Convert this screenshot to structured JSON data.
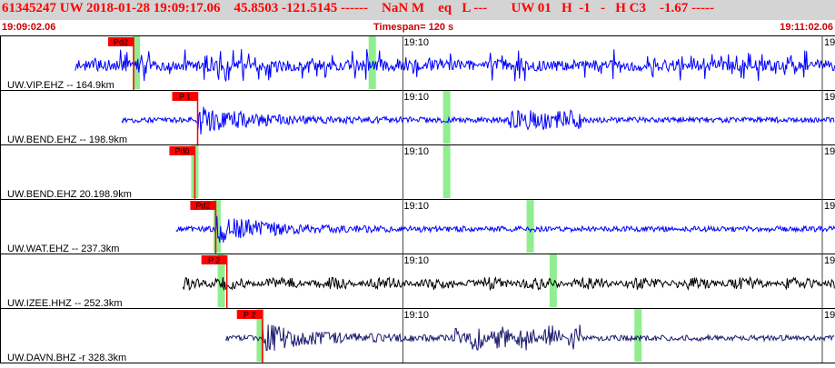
{
  "header": {
    "event_line": "61345247 UW 2018-01-28 19:09:17.06    45.8503 -121.5145 ------    NaN M    eq   L ---       UW 01   H  -1   -   H C3    -1.67 -----"
  },
  "timebar": {
    "start_time": "19:09:02.06",
    "timespan": "Timespan= 120 s",
    "end_time": "19:11:02.06"
  },
  "colors": {
    "header_bg": "#d4d4d4",
    "header_text": "#ff0000",
    "trace_blue": "#0000ff",
    "trace_black": "#000000",
    "trace_navy": "#1a1a6e",
    "pick_flag": "#ff0000",
    "marker_green": "#90ee90"
  },
  "panels": [
    {
      "label": "UW.VIP.EHZ -- 164.9km",
      "tick_label": "19:10",
      "edge_label": "19",
      "pick": {
        "label": "Pd2",
        "time_s": 19.2
      },
      "trace_color": "blue",
      "trace_start_s": 10.8,
      "green_marker_s": [
        19.6,
        53.5
      ]
    },
    {
      "label": "UW.BEND.EHZ -- 198.9km",
      "tick_label": "19:10",
      "edge_label": "19",
      "pick": {
        "label": "P 1",
        "time_s": 28.4
      },
      "trace_color": "blue",
      "trace_start_s": 17.5,
      "green_marker_s": [
        64.2
      ]
    },
    {
      "label": "UW.BEND.EHZ 20.198.9km",
      "tick_label": "19:10",
      "edge_label": "19",
      "pick": {
        "label": "Pd0",
        "time_s": 28.0
      },
      "trace_color": "none",
      "trace_start_s": null,
      "green_marker_s": [
        28.0,
        64.2
      ]
    },
    {
      "label": "UW.WAT.EHZ -- 237.3km",
      "tick_label": "19:10",
      "edge_label": "19",
      "pick": {
        "label": "Pd2",
        "time_s": 31.0
      },
      "trace_color": "blue",
      "trace_start_s": 25.3,
      "green_marker_s": [
        31.2,
        76.2
      ]
    },
    {
      "label": "UW.IZEE.HHZ -- 252.3km",
      "tick_label": "19:10",
      "edge_label": "19",
      "pick": {
        "label": "P 2",
        "time_s": 32.6
      },
      "trace_color": "black",
      "trace_start_s": 26.3,
      "green_marker_s": [
        31.8,
        79.5
      ]
    },
    {
      "label": "UW.DAVN.BHZ -r 328.3km",
      "tick_label": "19:10",
      "edge_label": "19",
      "pick": {
        "label": "P 2",
        "time_s": 37.7
      },
      "trace_color": "navy",
      "trace_start_s": 32.4,
      "green_marker_s": [
        37.4,
        91.7
      ]
    }
  ]
}
